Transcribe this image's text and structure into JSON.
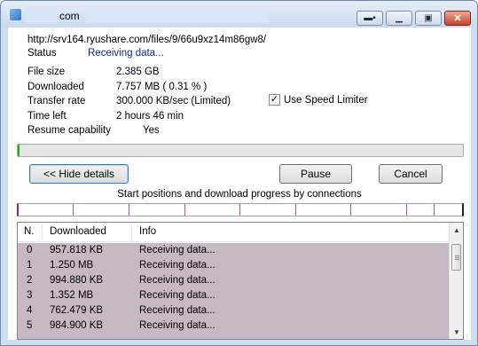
{
  "window": {
    "title": "com"
  },
  "details": {
    "url": "http://srv164.ryushare.com/files/9/66u9xz14m86gw8/",
    "status_label": "Status",
    "status_value": "Receiving data...",
    "file_size_label": "File size",
    "file_size_value": "2.385  GB",
    "downloaded_label": "Downloaded",
    "downloaded_value": "7.757  MB  ( 0.31 % )",
    "transfer_rate_label": "Transfer rate",
    "transfer_rate_value": "300.000  KB/sec  (Limited)",
    "time_left_label": "Time left",
    "time_left_value": "2 hours 46 min",
    "resume_label": "Resume capability",
    "resume_value": "Yes",
    "speed_limiter_label": "Use Speed Limiter",
    "speed_limiter_checked": true
  },
  "progress": {
    "percent": 0.31
  },
  "buttons": {
    "hide_details": "<< Hide details",
    "pause": "Pause",
    "cancel": "Cancel"
  },
  "connections": {
    "title": "Start positions and download progress by connections",
    "headers": [
      "N.",
      "Downloaded",
      "Info"
    ],
    "rows": [
      {
        "n": "0",
        "downloaded": "957.818  KB",
        "info": "Receiving data..."
      },
      {
        "n": "1",
        "downloaded": "1.250  MB",
        "info": "Receiving data..."
      },
      {
        "n": "2",
        "downloaded": "994.880  KB",
        "info": "Receiving data..."
      },
      {
        "n": "3",
        "downloaded": "1.352  MB",
        "info": "Receiving data..."
      },
      {
        "n": "4",
        "downloaded": "762.479  KB",
        "info": "Receiving data..."
      },
      {
        "n": "5",
        "downloaded": "984.900  KB",
        "info": "Receiving data..."
      }
    ]
  },
  "colors": {
    "progress_fill": "#16b11a",
    "list_row_bg": "#c6b9c4",
    "segment_tick": "#b84ab9",
    "status_text": "#0d2a8a"
  },
  "icons": {
    "app": "app-icon",
    "titlebar_extra": "download-options-icon",
    "minimize": "minimize-icon",
    "maximize": "maximize-icon",
    "close": "close-icon",
    "checkbox": "checkmark-icon",
    "scroll_up": "scroll-up-icon",
    "scroll_down": "scroll-down-icon"
  }
}
